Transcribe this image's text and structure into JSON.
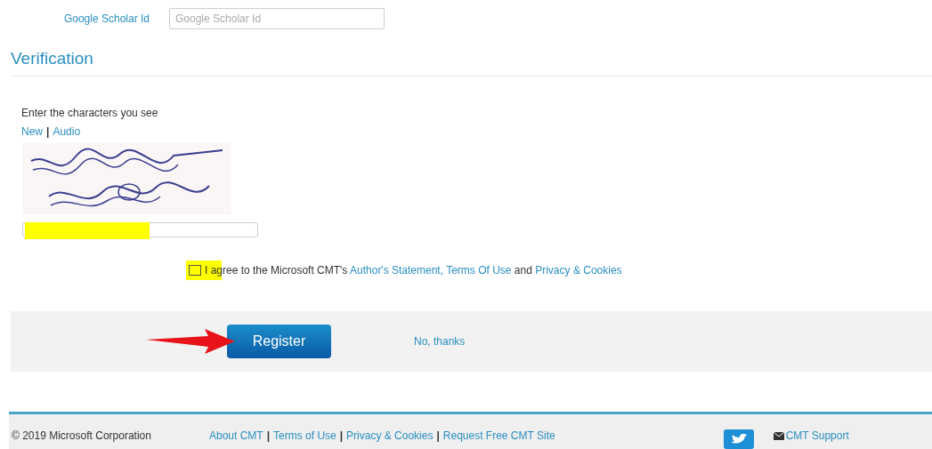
{
  "profile_field": {
    "label": "Google Scholar Id",
    "placeholder": "Google Scholar Id"
  },
  "verification": {
    "title": "Verification",
    "prompt": "Enter the characters you see",
    "links": [
      "New",
      "Audio"
    ],
    "separator": "|",
    "answer_highlight": {
      "level": 0.53
    },
    "agreement": {
      "checked": false,
      "parts": [
        {
          "kind": "text",
          "text": "I agree to the Microsoft CMT's "
        },
        {
          "kind": "link",
          "text": "Author's Statement, Terms Of Use"
        },
        {
          "kind": "text",
          "text": " and "
        },
        {
          "kind": "link",
          "text": "Privacy & Cookies"
        }
      ]
    }
  },
  "actions": {
    "primary": "Register",
    "secondary": "No, thanks"
  },
  "footer": {
    "copyright": "© 2019 Microsoft Corporation",
    "links": [
      "About CMT",
      "Terms of Use",
      "Privacy & Cookies",
      "Request Free CMT Site"
    ],
    "separator": "|",
    "support": "CMT Support"
  }
}
